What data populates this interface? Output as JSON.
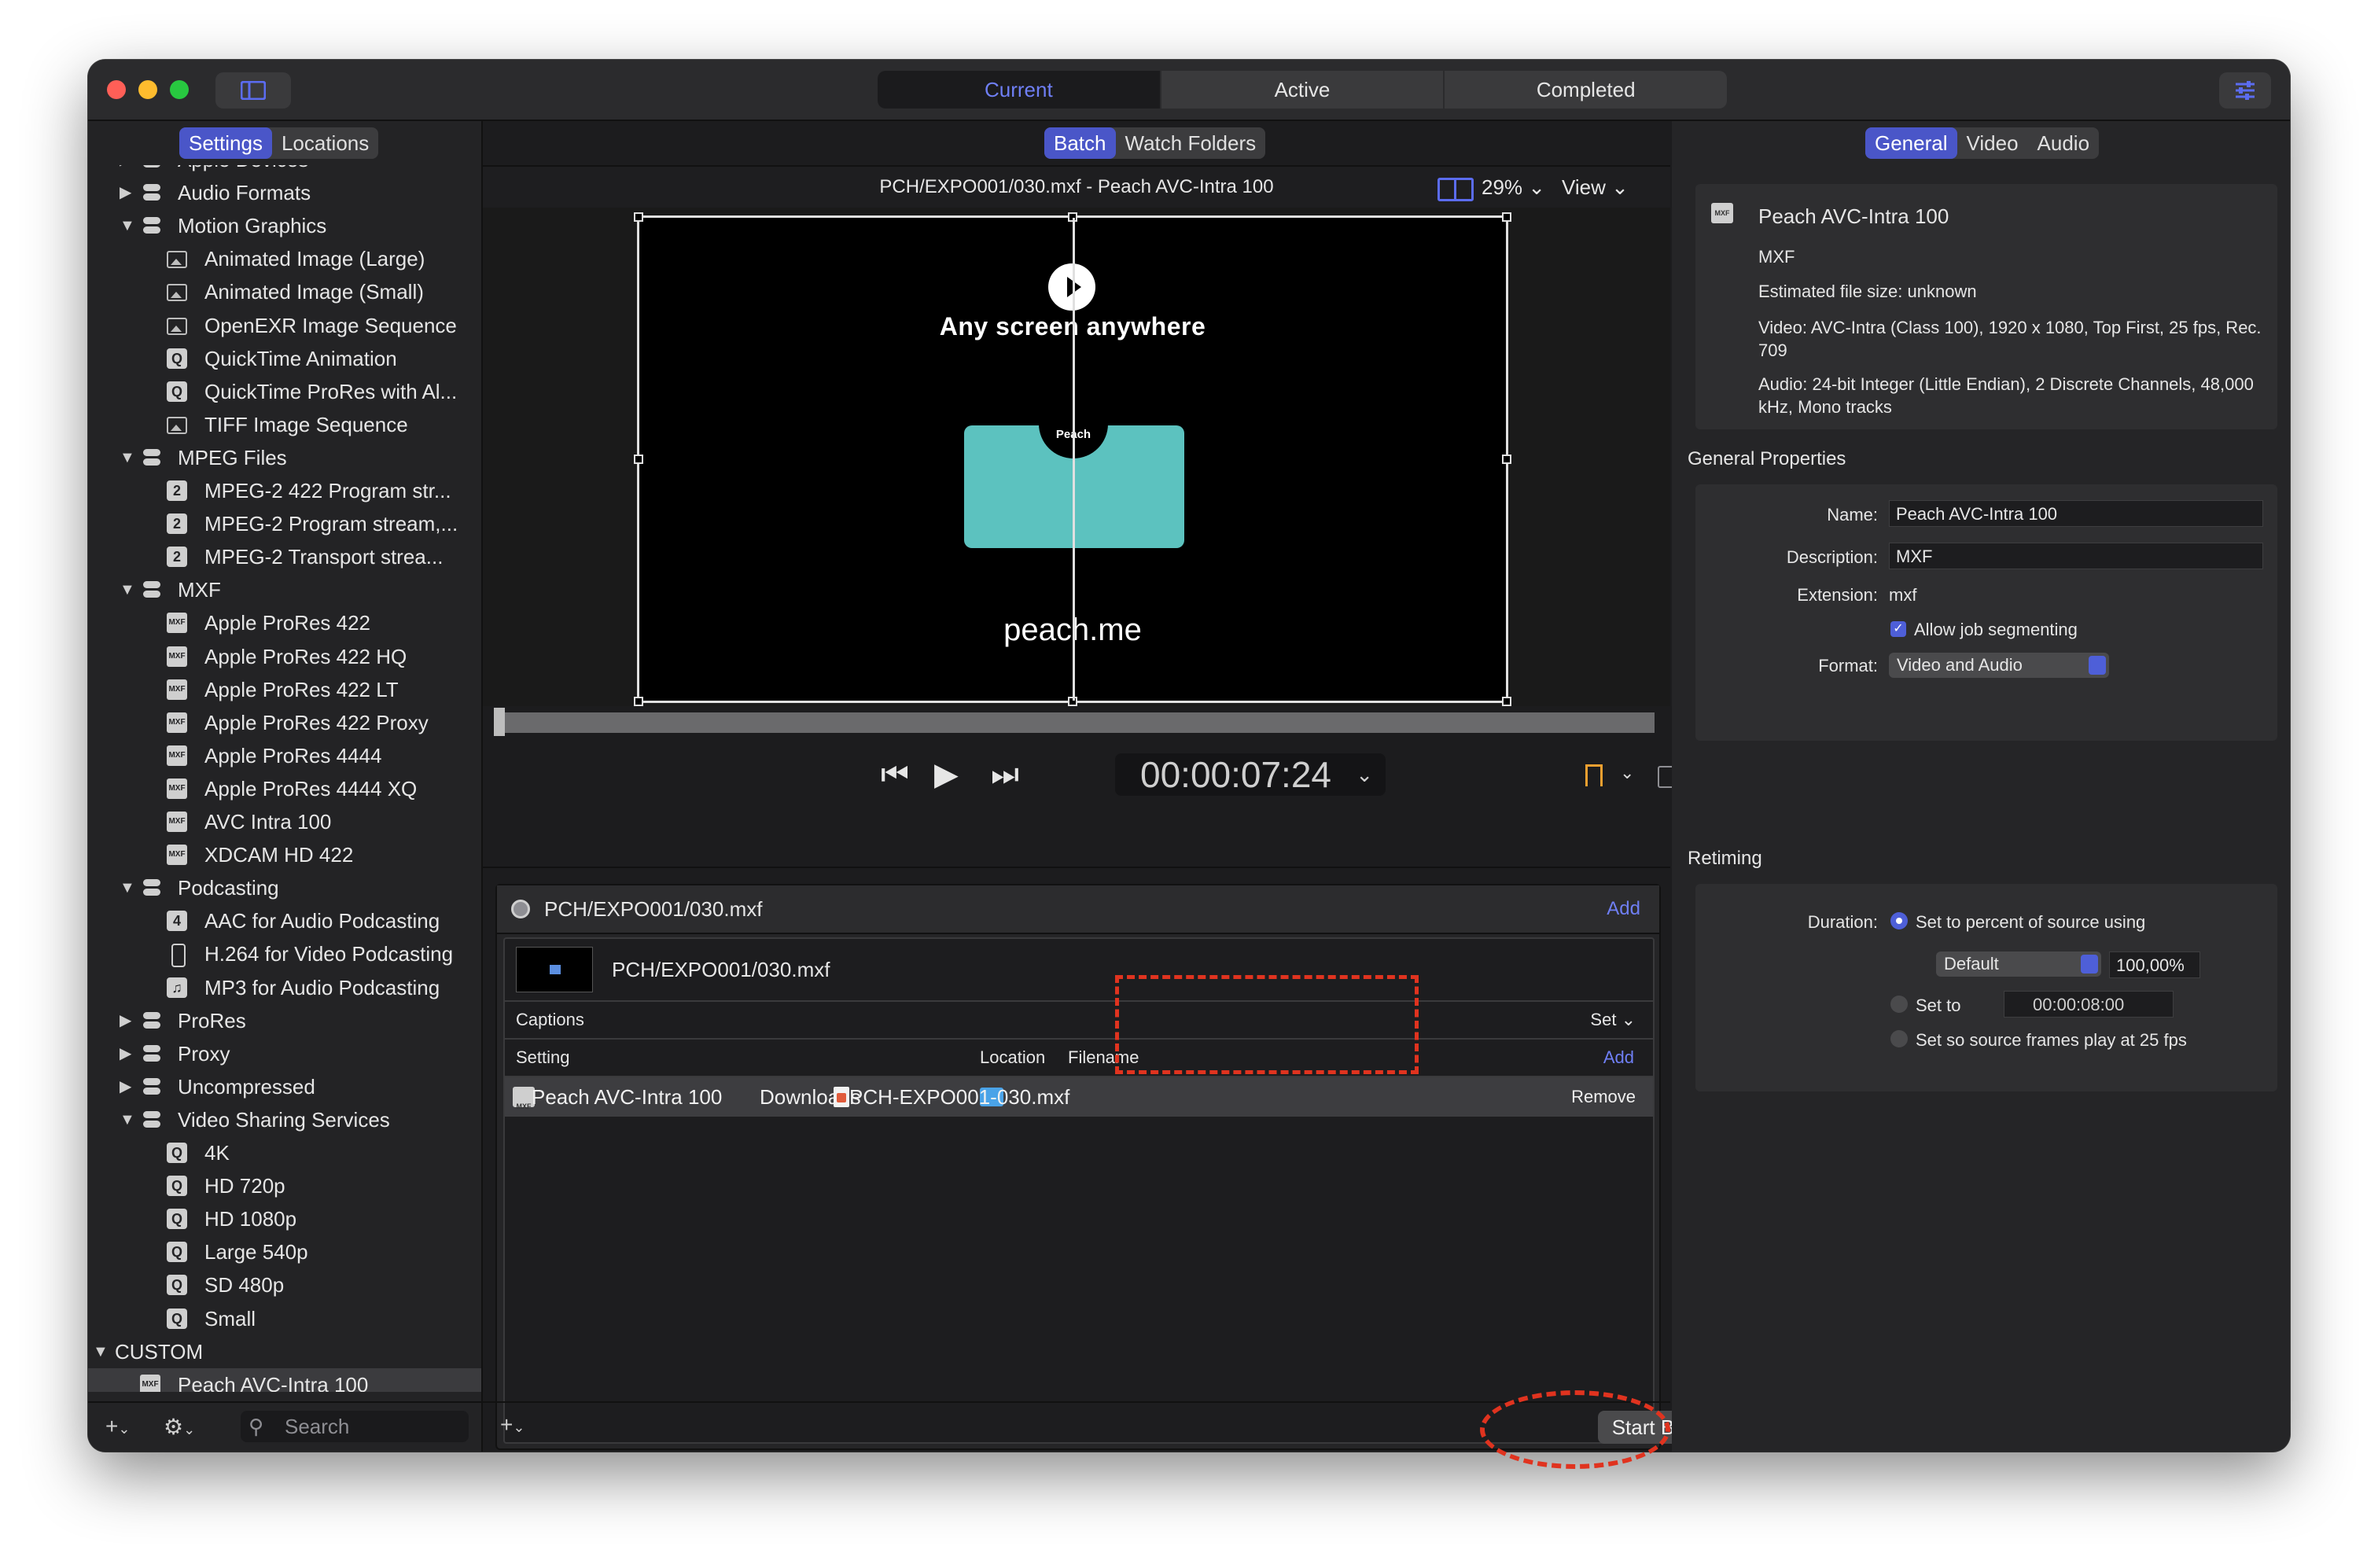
{
  "titlebar": {
    "tabs": [
      "Current",
      "Active",
      "Completed"
    ],
    "active_tab": "Current"
  },
  "sidebar": {
    "tabs": [
      "Settings",
      "Locations"
    ],
    "active_tab": "Settings",
    "items": [
      {
        "label": "Apple Devices",
        "level": 0,
        "icon": "toggle-icon",
        "expanded": false
      },
      {
        "label": "Audio Formats",
        "level": 0,
        "icon": "toggle-icon",
        "expanded": false
      },
      {
        "label": "Motion Graphics",
        "level": 0,
        "icon": "toggle-icon",
        "expanded": true
      },
      {
        "label": "Animated Image (Large)",
        "level": 1,
        "icon": "image-icon"
      },
      {
        "label": "Animated Image (Small)",
        "level": 1,
        "icon": "image-icon"
      },
      {
        "label": "OpenEXR Image Sequence",
        "level": 1,
        "icon": "image-icon"
      },
      {
        "label": "QuickTime Animation",
        "level": 1,
        "icon": "quicktime-icon"
      },
      {
        "label": "QuickTime ProRes with Al...",
        "level": 1,
        "icon": "quicktime-icon"
      },
      {
        "label": "TIFF Image Sequence",
        "level": 1,
        "icon": "image-icon"
      },
      {
        "label": "MPEG Files",
        "level": 0,
        "icon": "toggle-icon",
        "expanded": true
      },
      {
        "label": "MPEG-2 422 Program str...",
        "level": 1,
        "icon": "mpeg2-icon"
      },
      {
        "label": "MPEG-2 Program stream,...",
        "level": 1,
        "icon": "mpeg2-icon"
      },
      {
        "label": "MPEG-2 Transport strea...",
        "level": 1,
        "icon": "mpeg2-icon"
      },
      {
        "label": "MXF",
        "level": 0,
        "icon": "toggle-icon",
        "expanded": true
      },
      {
        "label": "Apple ProRes 422",
        "level": 1,
        "icon": "mxf-icon"
      },
      {
        "label": "Apple ProRes 422 HQ",
        "level": 1,
        "icon": "mxf-icon"
      },
      {
        "label": "Apple ProRes 422 LT",
        "level": 1,
        "icon": "mxf-icon"
      },
      {
        "label": "Apple ProRes 422 Proxy",
        "level": 1,
        "icon": "mxf-icon"
      },
      {
        "label": "Apple ProRes 4444",
        "level": 1,
        "icon": "mxf-icon"
      },
      {
        "label": "Apple ProRes 4444 XQ",
        "level": 1,
        "icon": "mxf-icon"
      },
      {
        "label": "AVC Intra 100",
        "level": 1,
        "icon": "mxf-icon"
      },
      {
        "label": "XDCAM HD 422",
        "level": 1,
        "icon": "mxf-icon"
      },
      {
        "label": "Podcasting",
        "level": 0,
        "icon": "toggle-icon",
        "expanded": true
      },
      {
        "label": "AAC for Audio Podcasting",
        "level": 1,
        "icon": "mpeg4-icon"
      },
      {
        "label": "H.264 for Video Podcasting",
        "level": 1,
        "icon": "phone-icon"
      },
      {
        "label": "MP3 for Audio Podcasting",
        "level": 1,
        "icon": "music-icon"
      },
      {
        "label": "ProRes",
        "level": 0,
        "icon": "toggle-icon",
        "expanded": false
      },
      {
        "label": "Proxy",
        "level": 0,
        "icon": "toggle-icon",
        "expanded": false
      },
      {
        "label": "Uncompressed",
        "level": 0,
        "icon": "toggle-icon",
        "expanded": false
      },
      {
        "label": "Video Sharing Services",
        "level": 0,
        "icon": "toggle-icon",
        "expanded": true
      },
      {
        "label": "4K",
        "level": 1,
        "icon": "quicktime-icon"
      },
      {
        "label": "HD 720p",
        "level": 1,
        "icon": "quicktime-icon"
      },
      {
        "label": "HD 1080p",
        "level": 1,
        "icon": "quicktime-icon"
      },
      {
        "label": "Large 540p",
        "level": 1,
        "icon": "quicktime-icon"
      },
      {
        "label": "SD 480p",
        "level": 1,
        "icon": "quicktime-icon"
      },
      {
        "label": "Small",
        "level": 1,
        "icon": "quicktime-icon"
      },
      {
        "label": "CUSTOM",
        "level": -1,
        "expanded": true
      },
      {
        "label": "Peach AVC-Intra 100",
        "level": 0,
        "icon": "mxf-icon",
        "selected": true
      }
    ],
    "search_placeholder": "Search"
  },
  "center": {
    "tabs": [
      "Batch",
      "Watch Folders"
    ],
    "active_tab": "Batch",
    "viewer_title": "PCH/EXPO001/030.mxf - Peach AVC-Intra 100",
    "zoom": "29%",
    "view_label": "View",
    "video": {
      "headline": "Any screen anywhere",
      "logo_text": "Peach",
      "url": "peach.me"
    },
    "timecode": "00:00:07:24",
    "batch": {
      "source_file": "PCH/EXPO001/030.mxf",
      "add_label": "Add",
      "job_file": "PCH/EXPO001/030.mxf",
      "captions_label": "Captions",
      "set_label": "Set",
      "columns": [
        "Setting",
        "Location",
        "Filename"
      ],
      "column_add_label": "Add",
      "output": {
        "setting": "Peach AVC-Intra 100",
        "location": "Downloads",
        "filename": "PCH-EXPO001-030.mxf",
        "remove_label": "Remove"
      }
    },
    "start_button": "Start Batch"
  },
  "inspector": {
    "tabs": [
      "General",
      "Video",
      "Audio"
    ],
    "active_tab": "General",
    "summary": {
      "title": "Peach AVC-Intra 100",
      "format": "MXF",
      "file_size": "Estimated file size: unknown",
      "video": "Video: AVC-Intra (Class 100), 1920 x 1080, Top First, 25 fps, Rec. 709",
      "audio": "Audio: 24-bit Integer (Little Endian), 2 Discrete Channels, 48,000 kHz, Mono tracks"
    },
    "general_properties": {
      "section_title": "General Properties",
      "name_label": "Name:",
      "name_value": "Peach AVC-Intra 100",
      "description_label": "Description:",
      "description_value": "MXF",
      "extension_label": "Extension:",
      "extension_value": "mxf",
      "segmenting_label": "Allow job segmenting",
      "segmenting_checked": true,
      "format_label": "Format:",
      "format_value": "Video and Audio"
    },
    "retiming": {
      "section_title": "Retiming",
      "duration_label": "Duration:",
      "option_percent": "Set to percent of source using",
      "preset_value": "Default",
      "percent_value": "100,00%",
      "option_set_to": "Set to",
      "set_to_value": "00:00:08:00",
      "option_frames": "Set so source frames play at 25 fps",
      "selected_option": "percent"
    }
  },
  "colors": {
    "accent": "#4e5fd8",
    "annotation_red": "#e0331f",
    "teal": "#5cc2bf"
  }
}
